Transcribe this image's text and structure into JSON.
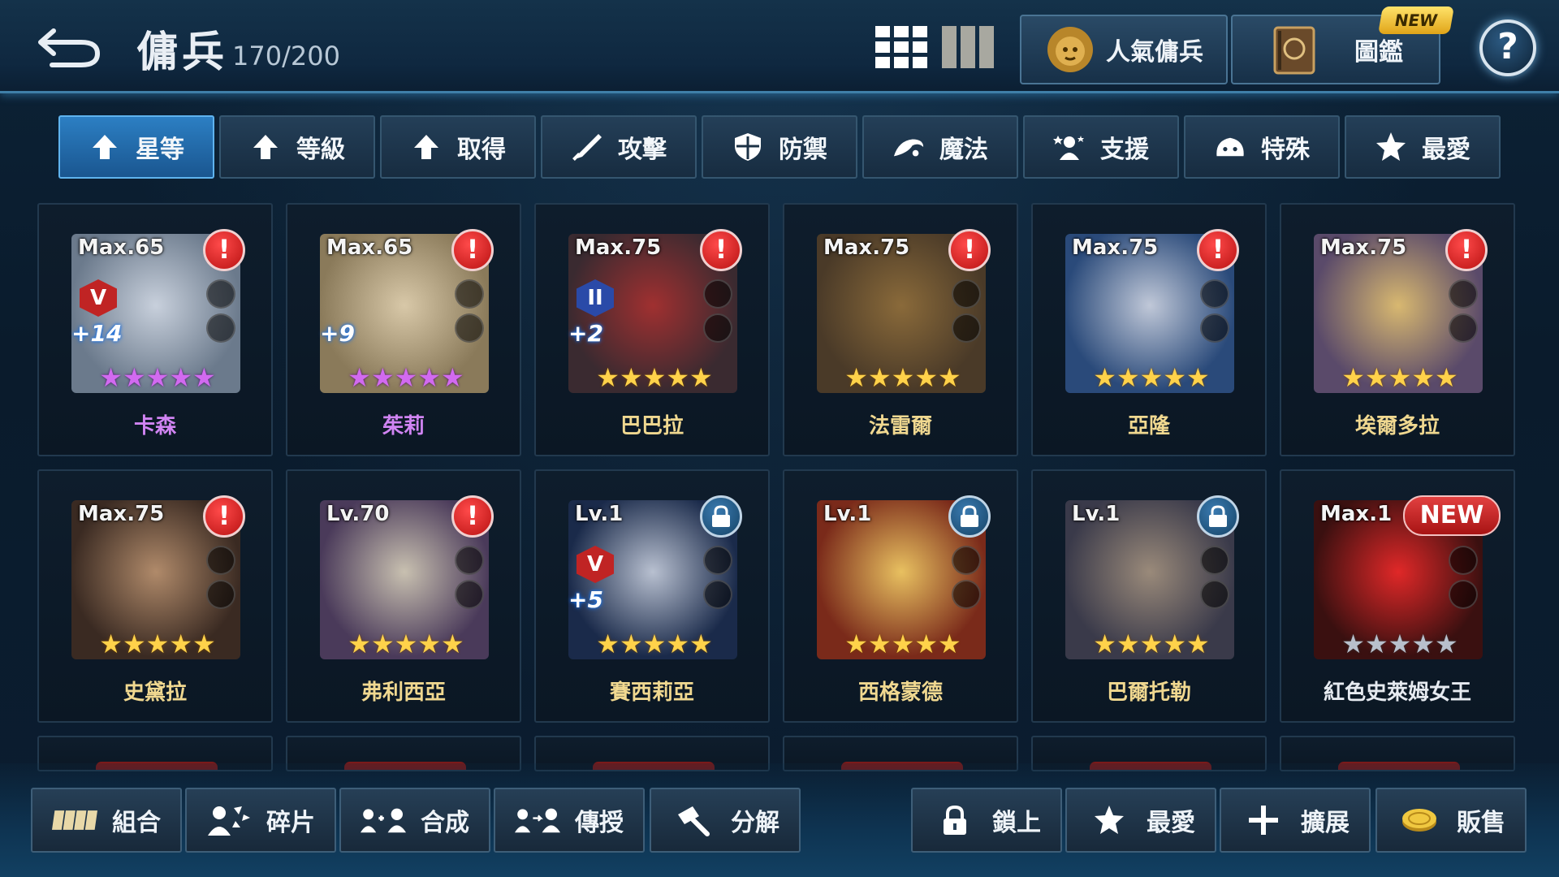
{
  "header": {
    "title": "傭兵",
    "count": "170/200",
    "popular_label": "人氣傭兵",
    "codex_label": "圖鑑",
    "new_badge": "NEW",
    "help_label": "?"
  },
  "tabs": [
    {
      "label": "星等",
      "icon": "arrow-up-icon",
      "active": true
    },
    {
      "label": "等級",
      "icon": "arrow-up-icon",
      "active": false
    },
    {
      "label": "取得",
      "icon": "arrow-up-icon",
      "active": false
    },
    {
      "label": "攻擊",
      "icon": "sword-icon",
      "active": false
    },
    {
      "label": "防禦",
      "icon": "shield-icon",
      "active": false
    },
    {
      "label": "魔法",
      "icon": "magic-icon",
      "active": false
    },
    {
      "label": "支援",
      "icon": "support-icon",
      "active": false
    },
    {
      "label": "特殊",
      "icon": "special-icon",
      "active": false
    },
    {
      "label": "最愛",
      "icon": "star-icon",
      "active": false
    }
  ],
  "mercenaries": [
    {
      "level": "Max.65",
      "name": "卡森",
      "rank": "V",
      "plus": "+14",
      "stars": 5,
      "star_color": "purple",
      "name_color": "purple",
      "status": "alert",
      "colors": [
        "#6b7a8c",
        "#c8d0dc"
      ]
    },
    {
      "level": "Max.65",
      "name": "茱莉",
      "rank": "",
      "plus": "+9",
      "stars": 5,
      "star_color": "purple",
      "name_color": "purple",
      "status": "alert",
      "colors": [
        "#8a7a5a",
        "#d8c8a8"
      ]
    },
    {
      "level": "Max.75",
      "name": "巴巴拉",
      "rank": "II",
      "plus": "+2",
      "stars": 5,
      "star_color": "gold",
      "name_color": "gold",
      "status": "alert",
      "colors": [
        "#3a2a30",
        "#a03030"
      ]
    },
    {
      "level": "Max.75",
      "name": "法雷爾",
      "rank": "",
      "plus": "",
      "stars": 5,
      "star_color": "gold",
      "name_color": "gold",
      "status": "alert",
      "colors": [
        "#4a3a28",
        "#8a6a3a"
      ]
    },
    {
      "level": "Max.75",
      "name": "亞隆",
      "rank": "",
      "plus": "",
      "stars": 5,
      "star_color": "gold",
      "name_color": "gold",
      "status": "alert",
      "colors": [
        "#2a4a7a",
        "#c0c8d8"
      ]
    },
    {
      "level": "Max.75",
      "name": "埃爾多拉",
      "rank": "",
      "plus": "",
      "stars": 5,
      "star_color": "gold",
      "name_color": "gold",
      "status": "alert",
      "colors": [
        "#5a4a6a",
        "#d8b870"
      ]
    },
    {
      "level": "Max.75",
      "name": "史黛拉",
      "rank": "",
      "plus": "",
      "stars": 5,
      "star_color": "gold",
      "name_color": "gold",
      "status": "alert",
      "colors": [
        "#3a2a22",
        "#b08a6a"
      ]
    },
    {
      "level": "Lv.70",
      "name": "弗利西亞",
      "rank": "",
      "plus": "",
      "stars": 5,
      "star_color": "gold",
      "name_color": "gold",
      "status": "alert",
      "colors": [
        "#4a3a5a",
        "#c8c0b0"
      ]
    },
    {
      "level": "Lv.1",
      "name": "賽西莉亞",
      "rank": "V",
      "plus": "+5",
      "stars": 5,
      "star_color": "gold",
      "name_color": "gold",
      "status": "lock",
      "colors": [
        "#1a2a4a",
        "#b8c0d0"
      ]
    },
    {
      "level": "Lv.1",
      "name": "西格蒙德",
      "rank": "",
      "plus": "",
      "stars": 5,
      "star_color": "gold",
      "name_color": "gold",
      "status": "lock",
      "colors": [
        "#7a2a1a",
        "#e8c060"
      ]
    },
    {
      "level": "Lv.1",
      "name": "巴爾托勒",
      "rank": "",
      "plus": "",
      "stars": 5,
      "star_color": "gold",
      "name_color": "gold",
      "status": "lock",
      "colors": [
        "#3a3a4a",
        "#9a8a7a"
      ]
    },
    {
      "level": "Max.1",
      "name": "紅色史萊姆女王",
      "rank": "",
      "plus": "",
      "stars": 5,
      "star_color": "grey",
      "name_color": "white",
      "status": "new",
      "colors": [
        "#3a1010",
        "#e02828"
      ],
      "tag": "NEW"
    }
  ],
  "bottom_buttons": [
    {
      "label": "組合",
      "icon": "group-icon"
    },
    {
      "label": "碎片",
      "icon": "fragments-icon"
    },
    {
      "label": "合成",
      "icon": "combine-icon"
    },
    {
      "label": "傳授",
      "icon": "transfer-icon"
    },
    {
      "label": "分解",
      "icon": "hammer-icon"
    },
    {
      "label": "鎖上",
      "icon": "lock-icon"
    },
    {
      "label": "最愛",
      "icon": "star-icon"
    },
    {
      "label": "擴展",
      "icon": "plus-icon"
    },
    {
      "label": "販售",
      "icon": "coin-icon"
    }
  ]
}
